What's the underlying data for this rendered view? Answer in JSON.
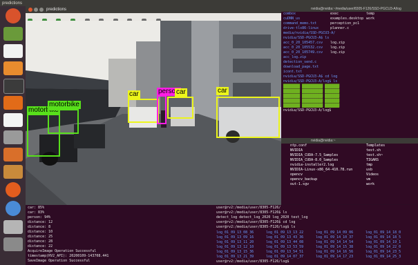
{
  "topbar": {
    "title": "predictions"
  },
  "detection_window": {
    "title": "predictions",
    "detections": [
      {
        "label": "motorbike",
        "color": "#58e01b"
      },
      {
        "label": "motorbike",
        "color": "#58e01b"
      },
      {
        "label": "car",
        "color": "#ecf51b"
      },
      {
        "label": "person",
        "color": "#ff1ee6"
      },
      {
        "label": "car",
        "color": "#ecf51b"
      },
      {
        "label": "car",
        "color": "#ecf51b"
      }
    ]
  },
  "terminal_top": {
    "title": "nvidia@nvidia:~/media/user/8305-F126/SSD-PGCU3-A/log",
    "lines": [
      [
        "",
        "combox",
        "exec",
        "temp"
      ],
      [
        "",
        "cuDNN_us",
        "examples.desktop",
        "work"
      ],
      [
        "",
        "command_memo.txt",
        "perception_pc1",
        ""
      ],
      [
        "",
        "drive-tlx86-linux",
        "planner.c",
        ""
      ],
      [
        "",
        "media/nvidia/SSD-PGCU3-A/",
        "",
        ""
      ],
      [
        "",
        "nvidia/SSD-PGCU3-A$ ls",
        "",
        ""
      ],
      [
        "",
        "acc_0_20_105457.csv",
        "log.zip",
        ""
      ],
      [
        "",
        "acc_0_20_105532.csv",
        "log.zip",
        ""
      ],
      [
        "",
        "acc_0_20_105749.csv",
        "log.zip",
        ""
      ],
      [
        "",
        "acc_log.zip",
        "",
        ""
      ],
      [
        "",
        "detection_send.c",
        "",
        ""
      ],
      [
        "",
        "download_page.txt",
        "",
        ""
      ],
      [
        "",
        "icont.txt",
        "",
        ""
      ],
      [
        "",
        "nvidia/SSD-PGCU3-A$ cd log",
        "",
        ""
      ],
      [
        "",
        "nvidia/SSD-PGCU3-A/log$ ls",
        "",
        ""
      ]
    ],
    "prompt_last": "nvidia/SSD-PGCU3-A/log$"
  },
  "terminal_mid": {
    "title": "nvidia@nvidia:~",
    "lines": [
      [
        "ntp.conf",
        "Templates"
      ],
      [
        "NVIDIA",
        "test.sh"
      ],
      [
        "NVIDIA_CUDA-7.5_Samples",
        "test.sh~"
      ],
      [
        "NVIDIA_CUDA-8.0_Samples",
        "TIGARS"
      ],
      [
        "nvidia-installer2.log",
        "tmp"
      ],
      [
        "NVIDIA-Linux-x86_64-410.78.run",
        "usb"
      ],
      [
        "opencv",
        "Videos"
      ],
      [
        "opencv_backup",
        "vm"
      ],
      [
        "out-1.sgv",
        "work"
      ]
    ]
  },
  "terminal_bottom_left": {
    "lines": [
      "car: 85%",
      "car: 83%",
      "person: 94%",
      "distance: 12",
      "distance: 8",
      "distance: 10",
      "distance: 25",
      "distance: 28",
      "distance: 22",
      "AcquireImage Operation Successful",
      " timestamp(RV2_API): 20200109-143708.441",
      "SaveImage Operation Successful"
    ]
  },
  "terminal_bottom_right": {
    "lines": [
      "user@rv2:/media/user/8305-F126/",
      "user@rv2:/media/user/8305-F126$ ls",
      "detect_log  detect_log_2020  log_2020  test_log",
      "user@rv2:/media/user/8305-F126$ cd log",
      "user@rv2:/media/user/8305-F126/log$ ls"
    ],
    "files": [
      [
        "log_01_09_13_08_36",
        "log_01_09_13_13_22",
        "log_01_09_14_09_06",
        "log_01_09_14_18_0"
      ],
      [
        "log_01_09_13_09_16",
        "log_01_09_13_43_36",
        "log_01_09_14_10_37",
        "log_01_09_14_18_5"
      ],
      [
        "log_01_09_13_11_20",
        "log_01_09_13_44_08",
        "log_01_09_14_14_54",
        "log_01_09_14_19_1"
      ],
      [
        "log_01_09_13_12_10",
        "log_01_09_13_53_59",
        "log_01_09_14_15_38",
        "log_01_09_14_22_0"
      ],
      [
        "log_01_09_13_15_36",
        "log_01_09_13_54_51",
        "log_01_09_14_16_56",
        "log_01_09_14_23_5"
      ],
      [
        "log_01_09_13_21_39",
        "log_01_09_14_07_37",
        "log_01_09_14_17_23",
        "log_01_09_14_25_3"
      ]
    ],
    "prompt_last": "user@rv2:/media/user/8305-F126/log$"
  }
}
